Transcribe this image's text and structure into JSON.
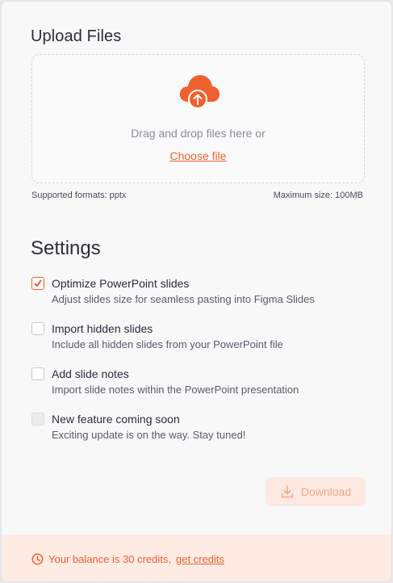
{
  "upload": {
    "title": "Upload Files",
    "drag_text": "Drag and drop files here or",
    "choose_label": "Choose file",
    "formats": "Supported formats: pptx",
    "max_size": "Maximum size: 100MB",
    "accent_color": "#f0612d"
  },
  "settings": {
    "title": "Settings",
    "options": [
      {
        "title": "Optimize PowerPoint slides",
        "desc": "Adjust slides size for seamless pasting into Figma Slides",
        "checked": true
      },
      {
        "title": "Import hidden slides",
        "desc": "Include all hidden slides from your PowerPoint file",
        "checked": false
      },
      {
        "title": "Add slide notes",
        "desc": "Import slide notes within the PowerPoint presentation",
        "checked": false
      },
      {
        "title": "New feature coming soon",
        "desc": "Exciting update is on the way. Stay tuned!",
        "checked": false,
        "disabled": true
      }
    ]
  },
  "download": {
    "label": "Download",
    "icon": "download-icon",
    "enabled": false
  },
  "footer": {
    "balance_text": "Your balance is 30 credits,",
    "get_credits_label": "get credits",
    "icon": "clock-icon"
  }
}
